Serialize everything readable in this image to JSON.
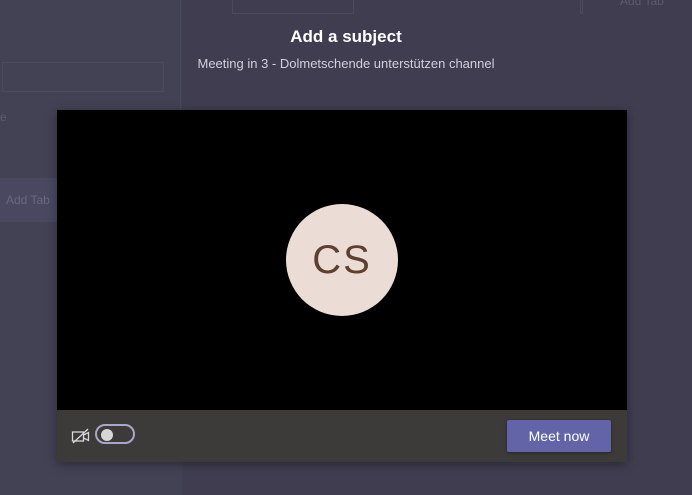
{
  "header": {
    "title": "Add a subject",
    "subtitle": "Meeting in 3 - Dolmetschende unterstützen channel"
  },
  "background": {
    "add_tab_label": "Add Tab",
    "top_right_text": "Add Tab",
    "faint_letter": "e"
  },
  "preview": {
    "avatar_initials": "CS",
    "camera_toggle_state": "off",
    "meet_now_label": "Meet now"
  },
  "colors": {
    "accent": "#6264a7",
    "overlay_bg": "#3f3d4f",
    "video_bg": "#000000",
    "controls_bg": "#3d3b39",
    "avatar_bg": "#ecdcd6",
    "avatar_text": "#5e4030"
  }
}
